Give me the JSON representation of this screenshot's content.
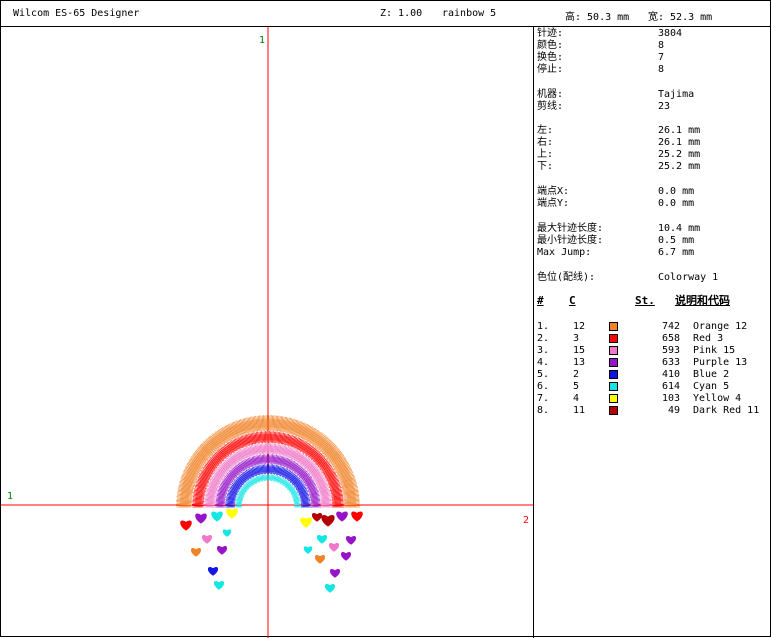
{
  "titlebar": {
    "app": "Wilcom ES-65 Designer",
    "zoom": "Z: 1.00",
    "design": "rainbow 5",
    "height": "高: 50.3 mm",
    "width": "宽: 52.3 mm"
  },
  "canvas": {
    "axis_top_label": "1",
    "axis_left_label": "1",
    "axis_right_label": "2",
    "axis_color": "#ff0000"
  },
  "info": {
    "stitches_label": "针迹:",
    "stitches": "3804",
    "colors_label": "颜色:",
    "colors": "8",
    "changes_label": "换色:",
    "changes": "7",
    "stops_label": "停止:",
    "stops": "8",
    "machine_label": "机器:",
    "machine": "Tajima",
    "trims_label": "剪线:",
    "trims": "23",
    "left_label": "左:",
    "left": "26.1 mm",
    "right_label": "右:",
    "right": "26.1 mm",
    "top_label": "上:",
    "top": "25.2 mm",
    "bottom_label": "下:",
    "bottom": "25.2 mm",
    "endx_label": "端点X:",
    "endx": "0.0 mm",
    "endy_label": "端点Y:",
    "endy": "0.0 mm",
    "maxlen_label": "最大针迹长度:",
    "maxlen": "10.4 mm",
    "minlen_label": "最小针迹长度:",
    "minlen": "0.5 mm",
    "maxjump_label": "Max Jump:",
    "maxjump": "6.7 mm",
    "colorway_label": "色位(配线):",
    "colorway": "Colorway 1"
  },
  "table": {
    "headers": {
      "num": "#",
      "code": "C",
      "st": "St.",
      "desc": "说明和代码"
    },
    "rows": [
      {
        "idx": "1.",
        "code": "12",
        "color": "#f08228",
        "st": "742",
        "desc": "Orange 12"
      },
      {
        "idx": "2.",
        "code": "3",
        "color": "#ff0000",
        "st": "658",
        "desc": "Red 3"
      },
      {
        "idx": "3.",
        "code": "15",
        "color": "#f078c8",
        "st": "593",
        "desc": "Pink 15"
      },
      {
        "idx": "4.",
        "code": "13",
        "color": "#9614c8",
        "st": "633",
        "desc": "Purple 13"
      },
      {
        "idx": "5.",
        "code": "2",
        "color": "#1414e6",
        "st": "410",
        "desc": "Blue 2"
      },
      {
        "idx": "6.",
        "code": "5",
        "color": "#14e6e6",
        "st": "614",
        "desc": "Cyan 5"
      },
      {
        "idx": "7.",
        "code": "4",
        "color": "#ffff00",
        "st": "103",
        "desc": "Yellow 4"
      },
      {
        "idx": "8.",
        "code": "11",
        "color": "#b40000",
        "st": "49",
        "desc": "Dark Red 11"
      }
    ]
  },
  "design_colors": {
    "orange": "#f08228",
    "red": "#ff0000",
    "pink": "#f078c8",
    "purple": "#9614c8",
    "blue": "#1414e6",
    "cyan": "#14e6e6",
    "yellow": "#ffff00",
    "darkred": "#b40000"
  }
}
